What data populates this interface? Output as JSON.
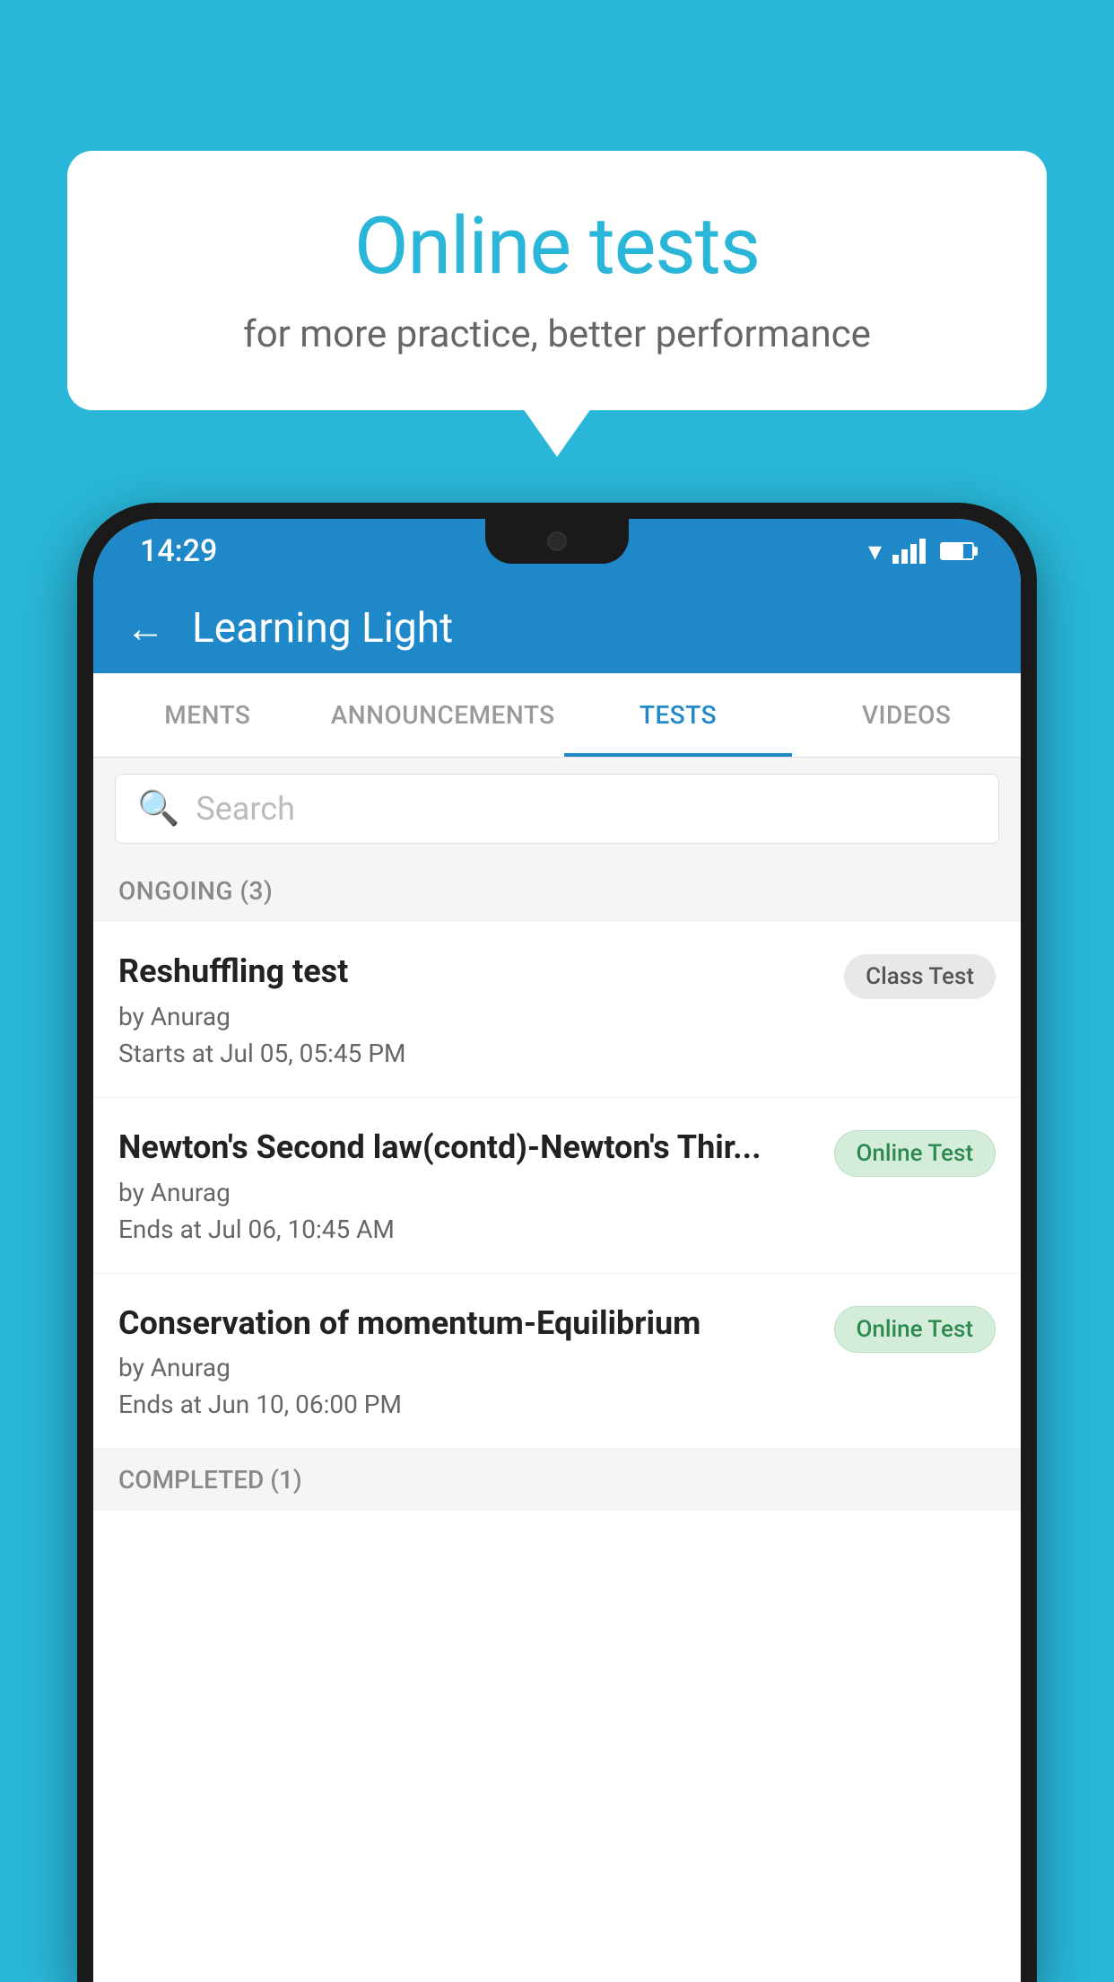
{
  "background": {
    "color": "#29b6d8"
  },
  "speech_bubble": {
    "title": "Online tests",
    "subtitle": "for more practice, better performance"
  },
  "status_bar": {
    "time": "14:29"
  },
  "app_header": {
    "title": "Learning Light",
    "back_label": "←"
  },
  "tabs": [
    {
      "label": "MENTS",
      "active": false
    },
    {
      "label": "ANNOUNCEMENTS",
      "active": false
    },
    {
      "label": "TESTS",
      "active": true
    },
    {
      "label": "VIDEOS",
      "active": false
    }
  ],
  "search": {
    "placeholder": "Search"
  },
  "ongoing_section": {
    "label": "ONGOING (3)"
  },
  "tests": [
    {
      "name": "Reshuffling test",
      "author": "by Anurag",
      "time": "Starts at  Jul 05, 05:45 PM",
      "badge": "Class Test",
      "badge_type": "class"
    },
    {
      "name": "Newton's Second law(contd)-Newton's Thir...",
      "author": "by Anurag",
      "time": "Ends at  Jul 06, 10:45 AM",
      "badge": "Online Test",
      "badge_type": "online"
    },
    {
      "name": "Conservation of momentum-Equilibrium",
      "author": "by Anurag",
      "time": "Ends at  Jun 10, 06:00 PM",
      "badge": "Online Test",
      "badge_type": "online"
    }
  ],
  "completed_section": {
    "label": "COMPLETED (1)"
  }
}
